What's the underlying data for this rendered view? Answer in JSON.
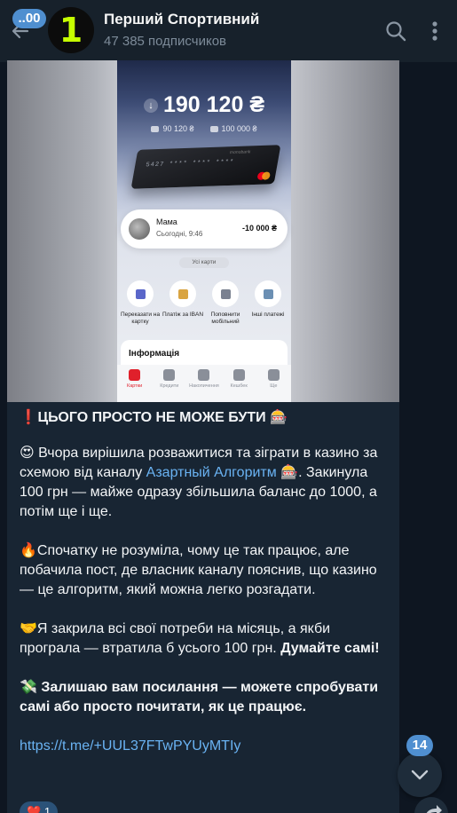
{
  "header": {
    "unread_count": "..00",
    "channel_name": "Перший Спортивний",
    "avatar_char": "1",
    "subscribers": "47 385 подписчиков"
  },
  "post": {
    "screenshot": {
      "balance": "190 120 ₴",
      "sub_balance_1": "90 120 ₴",
      "sub_balance_2": "100 000 ₴",
      "card_number": "5427 **** **** ****",
      "card_bank": "monobank",
      "tx_name": "Мама",
      "tx_date": "Сьогодні, 9:46",
      "tx_amount": "-10 000 ₴",
      "all_cards": "Усі карти",
      "actions": [
        {
          "label": "Переказати на картку"
        },
        {
          "label": "Платіж за IBAN"
        },
        {
          "label": "Поповнити мобільний"
        },
        {
          "label": "Інші платежі"
        }
      ],
      "info_title": "Інформація",
      "nav": [
        {
          "label": "Картки"
        },
        {
          "label": "Кредити"
        },
        {
          "label": "Накопичення"
        },
        {
          "label": "Кешбек"
        },
        {
          "label": "Ще"
        }
      ]
    },
    "headline_emoji": "❗",
    "headline": "ЦЬОГО ПРОСТО НЕ МОЖЕ БУТИ",
    "headline_emoji_end": "🎰",
    "p1_emoji": "😍",
    "p1_a": "Вчора вирішила розважитися та зіграти в казино за схемою від каналу",
    "p1_link": "Азартный Алгоритм",
    "p1_emoji2": "🎰",
    "p1_b": ". Закинула 100 грн — майже одразу збільшила баланс до 1000, а потім ще і ще.",
    "p2_emoji": "🔥",
    "p2": "Спочатку не розуміла, чому це так працює, але побачила пост, де власник каналу пояснив, що казино — це алгоритм, який можна легко розгадати.",
    "p3_emoji": "🤝",
    "p3_a": "Я закрила всі свої потреби на місяць, а якби програла — втратила б усього 100 грн.",
    "p3_bold": "Думайте самі!",
    "p4_emoji": "💸",
    "p4_bold": "Залишаю вам посилання — можете спробувати самі або просто почитати, як це працює.",
    "url": "https://t.me/+UUL37FTwPYUyMTIy",
    "reaction_emoji": "❤️",
    "reaction_count": "1"
  },
  "floating": {
    "scroll_unread": "14"
  },
  "colors": {
    "background": "#0e1621",
    "header": "#17212b",
    "bubble": "#182533",
    "link": "#6ab3f3",
    "badge": "#4f8fd0",
    "avatar_accent": "#c6ff00"
  }
}
